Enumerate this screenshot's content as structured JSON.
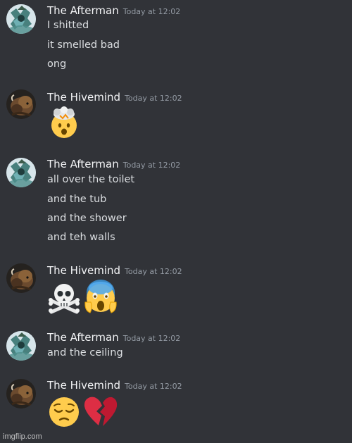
{
  "messages": [
    {
      "user": "The Afterman",
      "time": "Today at 12:02",
      "avatar_icon": "afterman-avatar-icon",
      "lines": [
        "I shitted",
        "it smelled bad",
        "ong"
      ]
    },
    {
      "user": "The Hivemind",
      "time": "Today at 12:02",
      "avatar_icon": "hivemind-avatar-icon",
      "emojis": [
        "exploding-head-emoji"
      ]
    },
    {
      "user": "The Afterman",
      "time": "Today at 12:02",
      "avatar_icon": "afterman-avatar-icon",
      "lines": [
        "all over the toilet",
        "and the tub",
        "and the shower",
        "and teh walls"
      ]
    },
    {
      "user": "The Hivemind",
      "time": "Today at 12:02",
      "avatar_icon": "hivemind-avatar-icon",
      "emojis": [
        "skull-crossbones-emoji",
        "screaming-face-emoji"
      ]
    },
    {
      "user": "The Afterman",
      "time": "Today at 12:02",
      "avatar_icon": "afterman-avatar-icon",
      "lines": [
        "and the ceiling"
      ]
    },
    {
      "user": "The Hivemind",
      "time": "Today at 12:02",
      "avatar_icon": "hivemind-avatar-icon",
      "emojis": [
        "pensive-face-emoji",
        "broken-heart-emoji"
      ]
    }
  ],
  "watermark": "imgflip.com",
  "colors": {
    "background": "#313338",
    "username": "#f2f3f5",
    "timestamp": "#949ba4",
    "message_text": "#dbdee1"
  }
}
